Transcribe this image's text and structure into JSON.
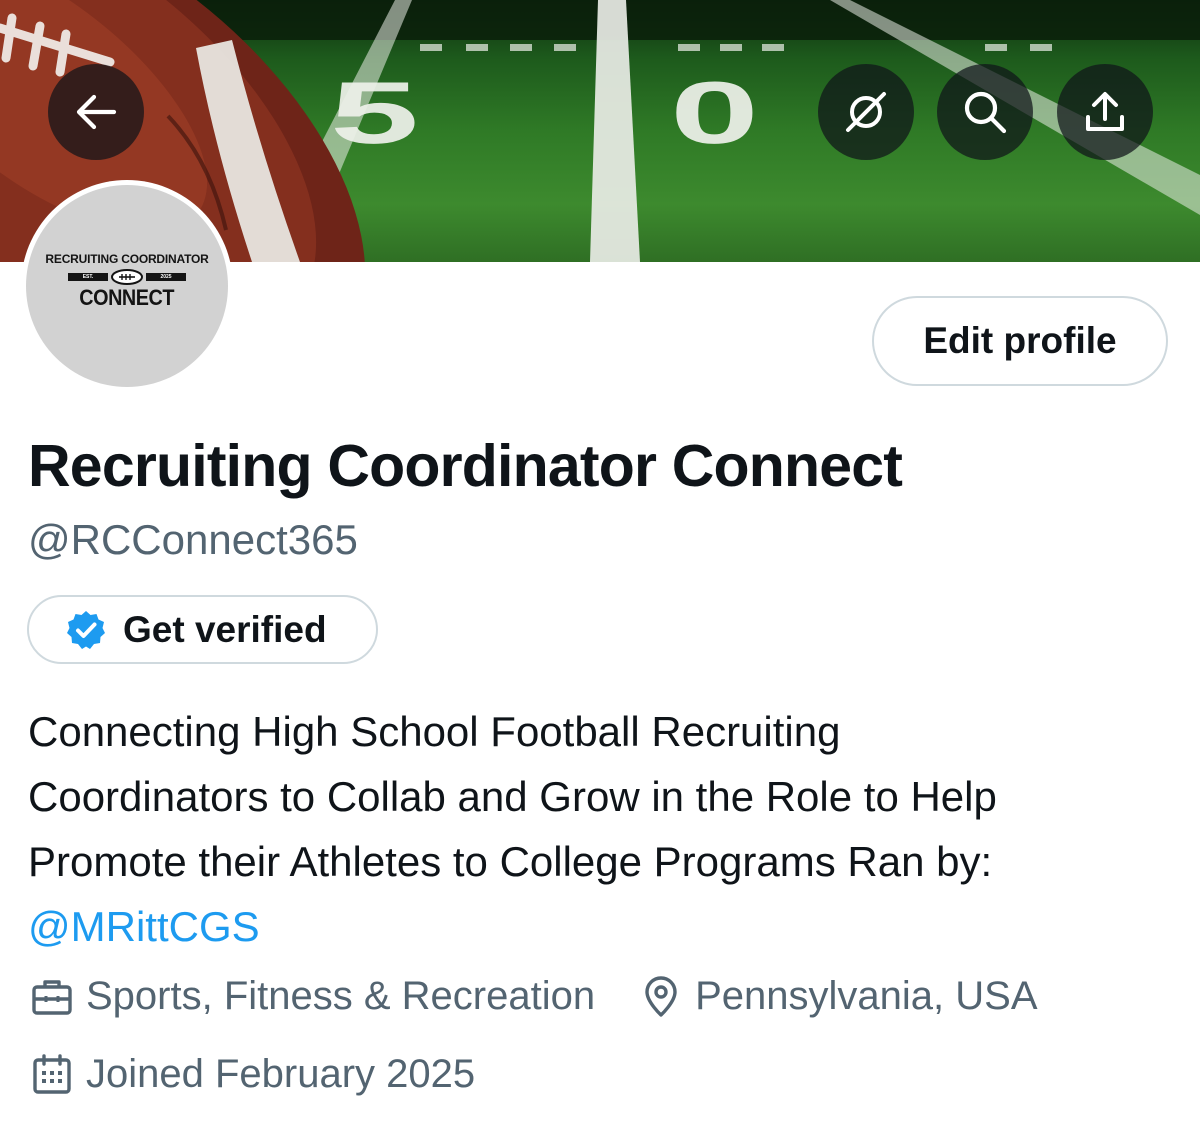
{
  "header": {
    "back_icon": "arrow-left-icon",
    "grok_icon": "grok-icon",
    "search_icon": "search-icon",
    "share_icon": "share-icon"
  },
  "banner": {
    "yard_number": "50"
  },
  "avatar": {
    "top_text": "RECRUITING COORDINATOR",
    "est_label": "EST.",
    "year_label": "2025",
    "bottom_text": "CONNECT"
  },
  "profile": {
    "edit_label": "Edit profile",
    "display_name": "Recruiting Coordinator Connect",
    "handle": "@RCConnect365",
    "verify_label": "Get verified",
    "bio_lines": [
      "Connecting High School Football Recruiting",
      "Coordinators to Collab and Grow in the Role to Help",
      "Promote their Athletes to College Programs Ran by:"
    ],
    "bio_mention": "@MRittCGS",
    "category": "Sports, Fitness & Recreation",
    "location": "Pennsylvania, USA",
    "joined": "Joined February 2025"
  },
  "colors": {
    "accent": "#1d9bf0",
    "secondary_text": "#536471",
    "border": "#cfd9de",
    "text": "#0f1419"
  }
}
